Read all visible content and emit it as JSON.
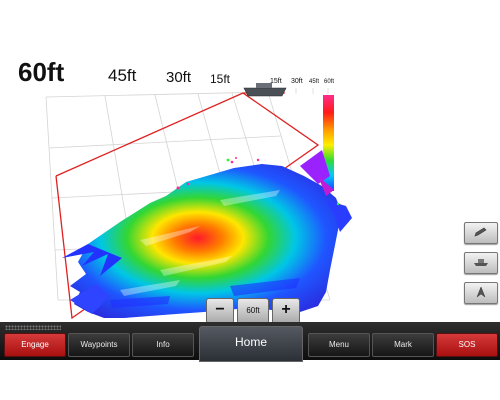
{
  "range_labels": {
    "back_row": [
      "60ft",
      "45ft",
      "30ft",
      "15ft"
    ],
    "far_row": [
      "15ft",
      "30ft",
      "45ft",
      "60ft"
    ]
  },
  "zoom": {
    "minus_label": "−",
    "level": "60ft",
    "plus_label": "+"
  },
  "side_buttons": [
    "pencil-icon",
    "boat-icon",
    "north-arrow-icon"
  ],
  "softkeys": {
    "engage": "Engage",
    "waypoints": "Waypoints",
    "info": "Info",
    "home": "Home",
    "menu": "Menu",
    "mark": "Mark",
    "sos": "SOS"
  },
  "colors": {
    "highlight_softkey": "#c51a1a",
    "cone_outline": "#e02020"
  }
}
